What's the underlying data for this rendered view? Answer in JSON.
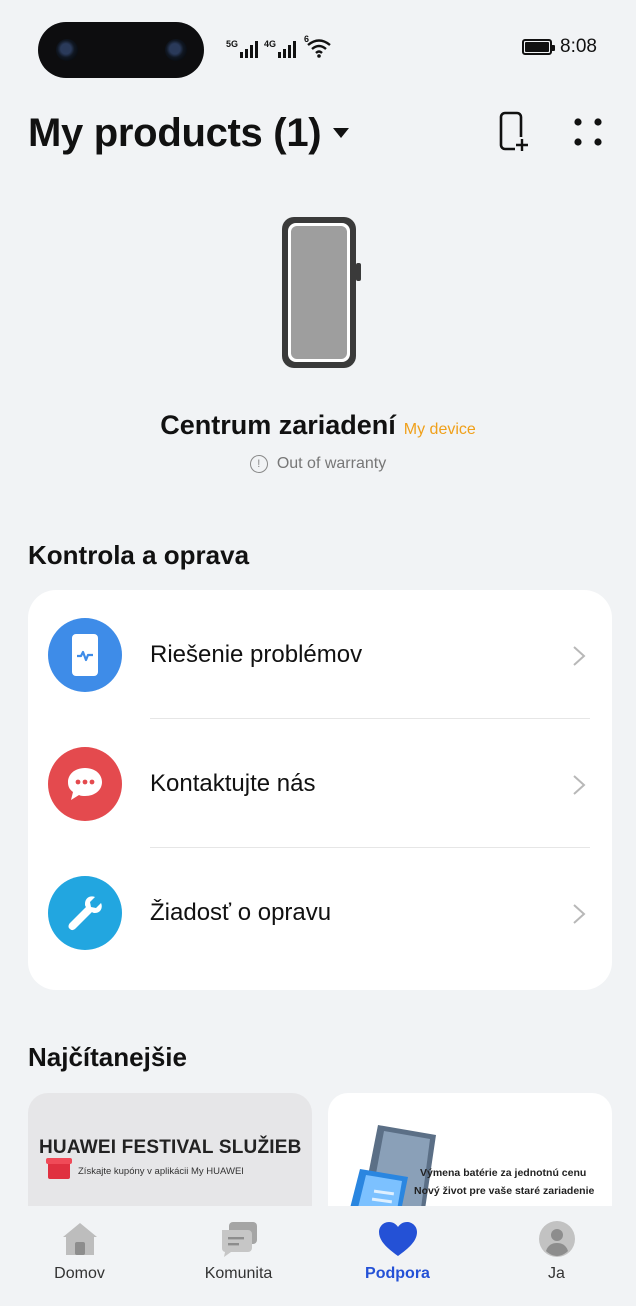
{
  "status_bar": {
    "time": "8:08",
    "signal1_label": "5G",
    "signal2_label": "4G",
    "wifi_label": "6"
  },
  "header": {
    "title": "My products (1)"
  },
  "device": {
    "name": "Centrum zariadení",
    "tag": "My device",
    "warranty": "Out of warranty"
  },
  "repair_section": {
    "title": "Kontrola a oprava",
    "items": [
      {
        "label": "Riešenie problémov",
        "icon": "phone-diagnostic-icon",
        "color": "#3e8ce8"
      },
      {
        "label": "Kontaktujte nás",
        "icon": "chat-bubble-icon",
        "color": "#e44a4e"
      },
      {
        "label": "Žiadosť o opravu",
        "icon": "wrench-icon",
        "color": "#22a6e0"
      }
    ]
  },
  "most_read": {
    "title": "Najčítanejšie",
    "banners": [
      {
        "title": "HUAWEI FESTIVAL SLUŽIEB",
        "subtitle": "Získajte kupóny v aplikácii My HUAWEI"
      },
      {
        "line1": "Výmena batérie za jednotnú cenu",
        "line2": "Nový život pre vaše staré zariadenie"
      }
    ]
  },
  "bottom_nav": {
    "items": [
      {
        "label": "Domov",
        "icon": "home-icon"
      },
      {
        "label": "Komunita",
        "icon": "community-icon"
      },
      {
        "label": "Podpora",
        "icon": "heart-icon",
        "active": true
      },
      {
        "label": "Ja",
        "icon": "profile-icon"
      }
    ]
  },
  "colors": {
    "accent": "#2451d6",
    "device_tag": "#f0a01a",
    "background": "#f1f3f5"
  }
}
